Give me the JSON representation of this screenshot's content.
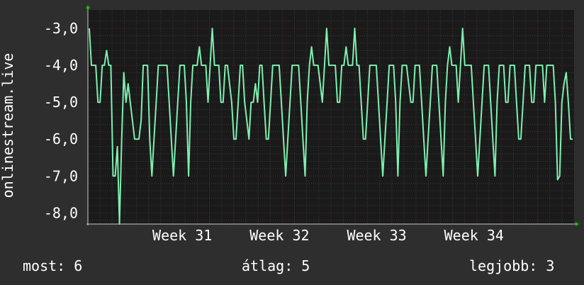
{
  "chart_data": {
    "type": "line",
    "ylabel": "onlinestream.live",
    "ylim": [
      -8.3,
      -2.5
    ],
    "y_ticks": [
      -3,
      -4,
      -5,
      -6,
      -7,
      -8
    ],
    "y_tick_labels": [
      "-3,0",
      "-4,0",
      "-5,0",
      "-6,0",
      "-7,0",
      "-8,0"
    ],
    "x_tick_labels": [
      "Week 31",
      "Week 32",
      "Week 33",
      "Week 34"
    ],
    "x_tick_positions": [
      0.2,
      0.4,
      0.6,
      0.8
    ],
    "grid": true,
    "colors": {
      "background": "#2e2e2e",
      "plot_bg": "#1a1a1a",
      "grid_minor": "#3a3a3a",
      "grid_major": "#5a2020",
      "line": "#7ef0b0",
      "arrow": "#00cc00"
    },
    "series": [
      {
        "values": [
          -3.0,
          -4.0,
          -4.0,
          -4.0,
          -5.0,
          -5.0,
          -4.0,
          -4.0,
          -3.6,
          -4.0,
          -4.0,
          -7.0,
          -7.0,
          -6.2,
          -8.3,
          -6.0,
          -4.2,
          -5.0,
          -4.5,
          -5.0,
          -5.5,
          -6.0,
          -6.0,
          -6.0,
          -5.5,
          -4.0,
          -4.0,
          -4.0,
          -6.0,
          -7.0,
          -6.0,
          -5.0,
          -4.0,
          -4.0,
          -4.0,
          -4.0,
          -4.0,
          -5.0,
          -6.0,
          -7.0,
          -6.0,
          -5.0,
          -4.0,
          -4.0,
          -4.0,
          -5.0,
          -7.0,
          -5.0,
          -4.0,
          -4.0,
          -4.0,
          -3.5,
          -4.0,
          -4.0,
          -4.0,
          -5.0,
          -4.0,
          -3.0,
          -4.0,
          -4.0,
          -4.0,
          -5.0,
          -5.0,
          -4.0,
          -4.0,
          -4.5,
          -5.0,
          -6.0,
          -6.0,
          -5.0,
          -4.0,
          -4.0,
          -5.0,
          -5.5,
          -6.0,
          -5.0,
          -5.0,
          -4.5,
          -5.0,
          -4.0,
          -4.0,
          -5.0,
          -6.0,
          -6.0,
          -5.0,
          -4.0,
          -4.0,
          -4.0,
          -4.0,
          -5.0,
          -6.0,
          -7.0,
          -6.0,
          -5.0,
          -4.0,
          -4.0,
          -4.0,
          -4.0,
          -5.0,
          -6.0,
          -7.0,
          -5.0,
          -4.0,
          -3.5,
          -4.0,
          -4.0,
          -4.0,
          -4.5,
          -5.0,
          -4.0,
          -3.0,
          -4.0,
          -4.0,
          -4.0,
          -4.0,
          -5.0,
          -5.0,
          -4.0,
          -4.0,
          -3.5,
          -4.0,
          -4.0,
          -4.0,
          -3.0,
          -4.0,
          -4.0,
          -5.0,
          -6.0,
          -6.0,
          -5.0,
          -4.0,
          -4.0,
          -4.0,
          -4.0,
          -5.0,
          -6.0,
          -7.0,
          -6.0,
          -5.0,
          -4.0,
          -4.0,
          -4.0,
          -5.0,
          -7.0,
          -5.0,
          -4.0,
          -4.0,
          -4.0,
          -4.5,
          -5.0,
          -5.0,
          -4.0,
          -4.0,
          -4.0,
          -5.0,
          -6.0,
          -7.0,
          -6.0,
          -5.0,
          -4.0,
          -4.0,
          -4.0,
          -5.0,
          -6.0,
          -7.0,
          -5.0,
          -4.0,
          -3.5,
          -4.0,
          -4.0,
          -4.0,
          -5.0,
          -4.0,
          -3.0,
          -4.0,
          -4.0,
          -4.0,
          -4.0,
          -5.0,
          -6.0,
          -7.0,
          -6.0,
          -5.0,
          -4.0,
          -4.0,
          -4.0,
          -5.0,
          -6.0,
          -7.0,
          -5.0,
          -4.0,
          -4.0,
          -4.0,
          -5.0,
          -5.0,
          -4.0,
          -4.0,
          -4.0,
          -5.0,
          -6.0,
          -6.0,
          -5.0,
          -4.0,
          -4.0,
          -4.0,
          -5.0,
          -5.0,
          -4.0,
          -4.0,
          -4.0,
          -4.0,
          -5.0,
          -4.0,
          -4.0,
          -4.0,
          -4.0,
          -5.0,
          -7.1,
          -7.0,
          -5.0,
          -4.5,
          -4.2,
          -5.0,
          -6.0,
          -6.0
        ]
      }
    ]
  },
  "stats": {
    "now": "most: 6",
    "avg": "átlag: 5",
    "best": "legjobb: 3"
  }
}
